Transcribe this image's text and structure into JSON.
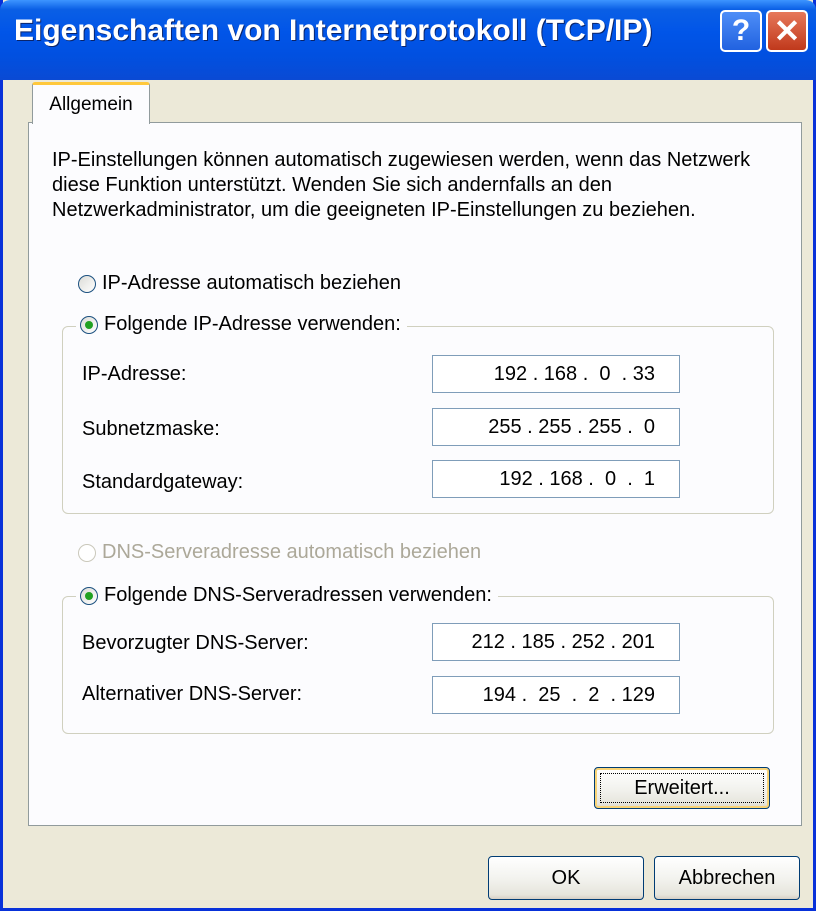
{
  "window": {
    "title": "Eigenschaften von Internetprotokoll (TCP/IP)",
    "help_label": "?",
    "close_label": "✕"
  },
  "tabs": [
    {
      "label": "Allgemein",
      "selected": true
    }
  ],
  "description": "IP-Einstellungen können automatisch zugewiesen werden, wenn das Netzwerk diese Funktion unterstützt. Wenden Sie sich andernfalls an den Netzwerkadministrator, um die geeigneten IP-Einstellungen zu beziehen.",
  "ip": {
    "auto_label": "IP-Adresse automatisch beziehen",
    "manual_label": "Folgende IP-Adresse verwenden:",
    "selected": "manual",
    "fields": [
      {
        "label": "IP-Adresse:",
        "value": "192 . 168 .  0  . 33"
      },
      {
        "label": "Subnetzmaske:",
        "value": "255 . 255 . 255 .  0"
      },
      {
        "label": "Standardgateway:",
        "value": "192 . 168 .  0  .  1"
      }
    ]
  },
  "dns": {
    "auto_label": "DNS-Serveradresse automatisch beziehen",
    "manual_label": "Folgende DNS-Serveradressen verwenden:",
    "auto_disabled": true,
    "selected": "manual",
    "fields": [
      {
        "label": "Bevorzugter DNS-Server:",
        "value": "212 . 185 . 252 . 201"
      },
      {
        "label": "Alternativer DNS-Server:",
        "value": "194 .  25  .  2  . 129"
      }
    ]
  },
  "buttons": {
    "advanced": "Erweitert...",
    "ok": "OK",
    "cancel": "Abbrechen"
  },
  "colors": {
    "titlebar": "#0155e8",
    "dialog_bg": "#ece9d8",
    "panel_bg": "#fcfcfe",
    "close_button": "#c0391c",
    "radio_checked": "#21a121",
    "tab_highlight": "#ffc83c"
  }
}
